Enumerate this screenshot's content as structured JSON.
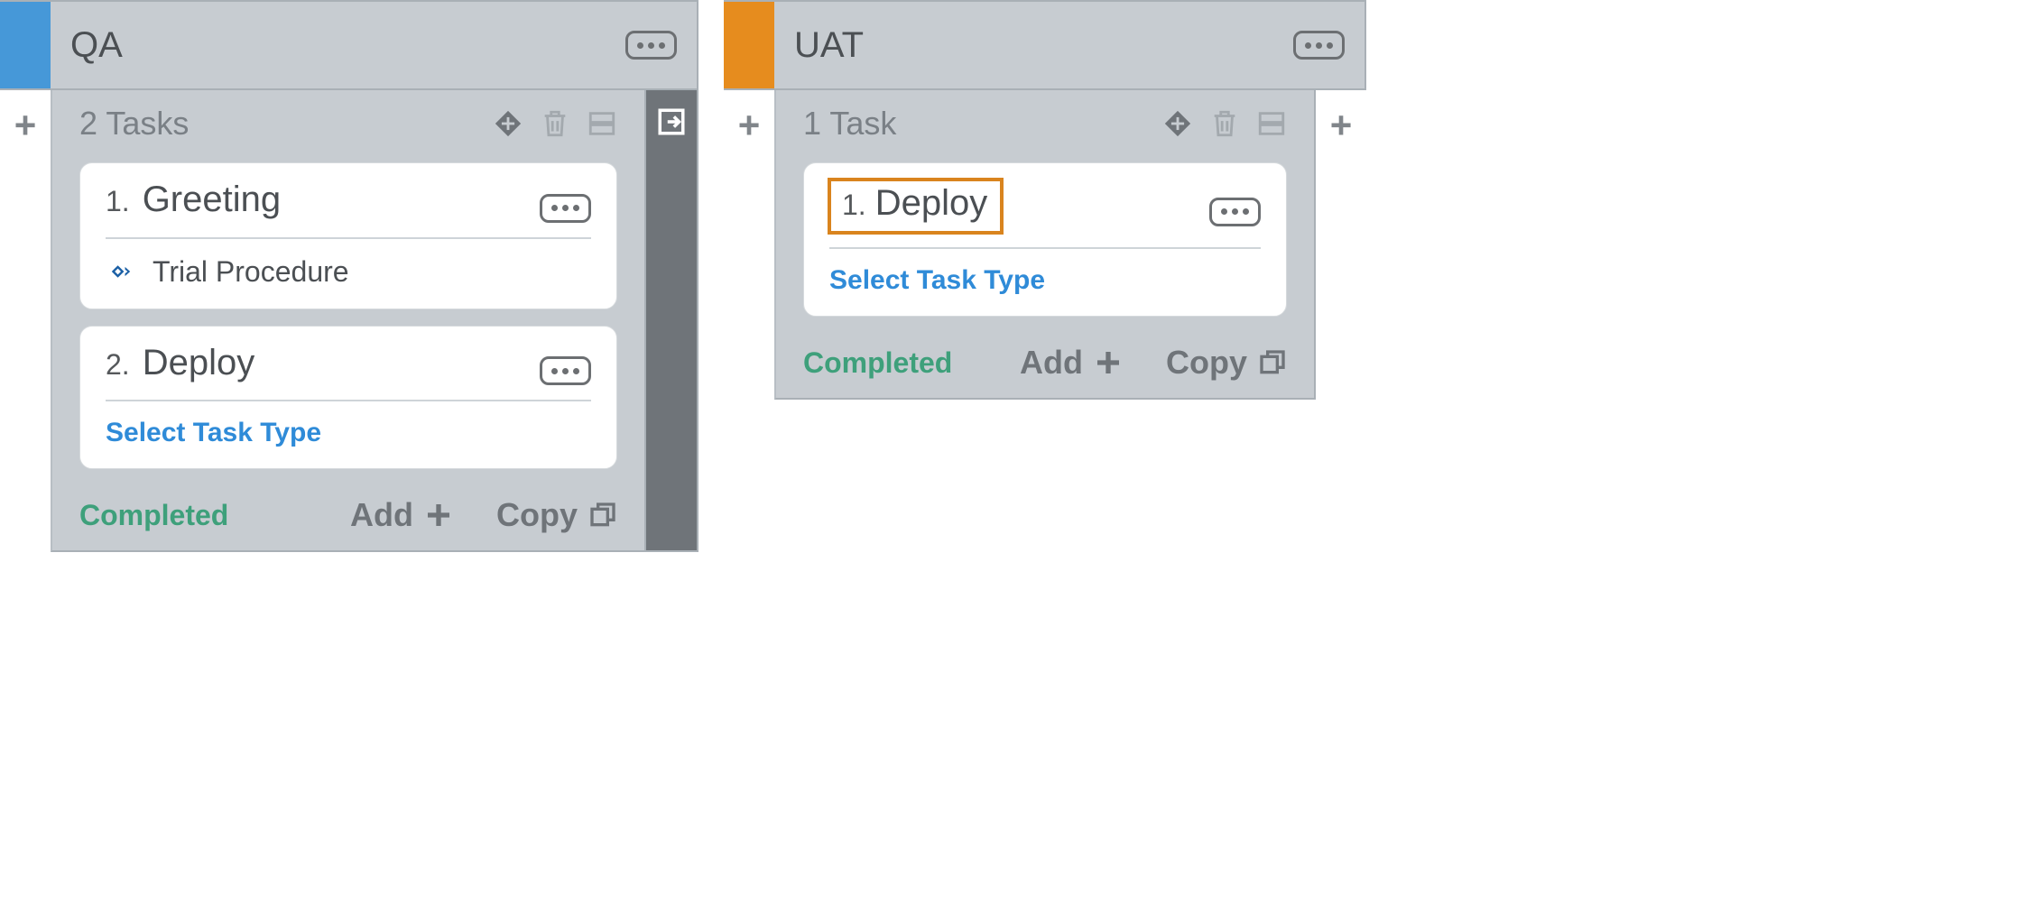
{
  "labels": {
    "select_task_type": "Select Task Type",
    "completed": "Completed",
    "add": "Add",
    "copy": "Copy"
  },
  "columns": [
    {
      "title": "QA",
      "accent": "blue",
      "task_count_label": "2 Tasks",
      "has_export_tray": true,
      "tasks": [
        {
          "num": "1.",
          "name": "Greeting",
          "body_type": "procedure",
          "procedure_label": "Trial Procedure",
          "highlighted": false
        },
        {
          "num": "2.",
          "name": "Deploy",
          "body_type": "select",
          "highlighted": false
        }
      ]
    },
    {
      "title": "UAT",
      "accent": "orange",
      "task_count_label": "1 Task",
      "has_export_tray": false,
      "trailing_plus": true,
      "tasks": [
        {
          "num": "1.",
          "name": "Deploy",
          "body_type": "select",
          "highlighted": true
        }
      ]
    }
  ]
}
